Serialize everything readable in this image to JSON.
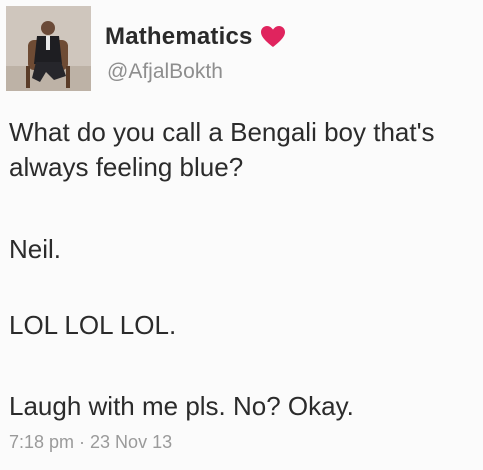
{
  "user": {
    "display_name": "Mathematics",
    "handle": "@AfjalBokth",
    "badge_icon": "heart-icon",
    "badge_color": "#e0245e"
  },
  "tweet": {
    "paragraphs": [
      "What do you call a Bengali boy that's always feeling blue?",
      "Neil.",
      "LOL LOL LOL.",
      "Laugh with me pls. No? Okay."
    ],
    "timestamp": "7:18 pm · 23 Nov 13"
  }
}
